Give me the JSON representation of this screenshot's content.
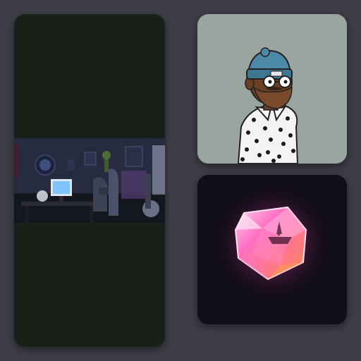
{
  "gallery": {
    "cards": [
      {
        "id": "room",
        "icon": "bedroom-desk-scene-image"
      },
      {
        "id": "pfp",
        "icon": "bearded-avatar-image"
      },
      {
        "id": "gem",
        "icon": "glowing-pink-gem-image"
      }
    ]
  },
  "colors": {
    "page_background": "#3e3d46",
    "room_card_background": "#182019",
    "avatar_card_background": "#9ba59f",
    "gem_card_background": "#120d1a",
    "gem_pink": "#ff6fc3",
    "gem_orange": "#ff9a55"
  }
}
